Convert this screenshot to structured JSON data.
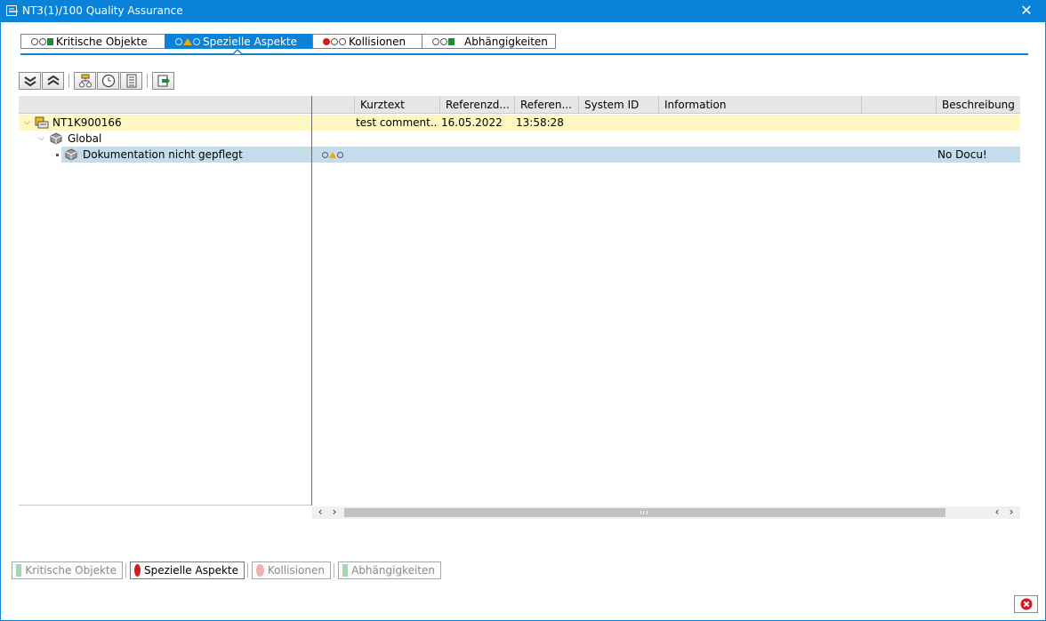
{
  "window": {
    "title": "NT3(1)/100 Quality Assurance",
    "icon": "transaction-window-icon",
    "close_glyph": "✕"
  },
  "tabs": [
    {
      "label": "Kritische Objekte",
      "active": false,
      "lights": [
        "grey-circle",
        "grey-circle",
        "green-square"
      ]
    },
    {
      "label": "Spezielle Aspekte",
      "active": true,
      "lights": [
        "grey-circle",
        "yellow-triangle",
        "grey-circle"
      ]
    },
    {
      "label": "Kollisionen",
      "active": false,
      "lights": [
        "red-circle",
        "grey-circle",
        "grey-circle"
      ]
    },
    {
      "label": "Abhängigkeiten",
      "active": false,
      "lights": [
        "grey-circle",
        "grey-circle",
        "green-square"
      ]
    }
  ],
  "toolbar": {
    "buttons": [
      "expand-all-icon",
      "collapse-all-icon",
      "hierarchy-icon",
      "clock-icon",
      "document-icon",
      "export-icon"
    ]
  },
  "columns": [
    "Kurztext",
    "Referenzd...",
    "Referen...",
    "System ID",
    "Information",
    "",
    "Beschreibung"
  ],
  "rows": [
    {
      "label": "NT1K900166",
      "icon": "transport-request-icon",
      "level": 0,
      "expanded": true,
      "kurztext": "test comment...",
      "referenzdatum": "16.05.2022",
      "referenzzeit": "13:58:28",
      "system_id": "",
      "information": "",
      "beschreibung": ""
    },
    {
      "label": "Global",
      "icon": "cube-icon",
      "level": 1,
      "expanded": true
    },
    {
      "label": "Dokumentation nicht gepflegt",
      "icon": "cube-icon",
      "level": 2,
      "selected": true,
      "status_lights": [
        "grey-circle",
        "yellow-triangle",
        "grey-circle"
      ],
      "beschreibung": "No Docu!"
    }
  ],
  "scroll": {
    "left_arrows": [
      "‹",
      "›"
    ],
    "right_arrows": [
      "‹",
      "›"
    ]
  },
  "bottom_buttons": [
    {
      "label": "Kritische Objekte",
      "enabled": false,
      "indicator": "square",
      "color": "#a9d5b5"
    },
    {
      "label": "Spezielle Aspekte",
      "enabled": true,
      "indicator": "circle",
      "color": "#d6181f"
    },
    {
      "label": "Kollisionen",
      "enabled": false,
      "indicator": "circle",
      "color": "#efb1b1"
    },
    {
      "label": "Abhängigkeiten",
      "enabled": false,
      "indicator": "square",
      "color": "#a9d5b5"
    }
  ],
  "colors": {
    "accent": "#0a82d8",
    "highlight_row": "#fff7c2",
    "selected_row": "#c5dcea"
  }
}
